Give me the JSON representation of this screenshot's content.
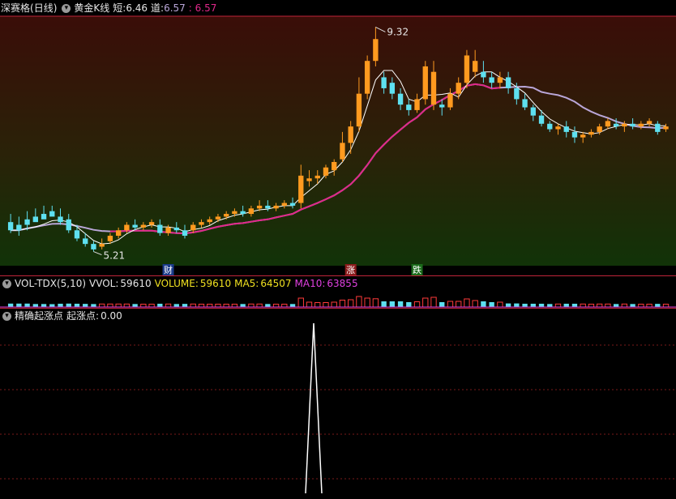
{
  "main": {
    "stock_name": "深赛格",
    "period": "(日线)",
    "indicator_name": "黄金K线",
    "short_label": "短:",
    "short_value": "6.46",
    "mid_label": "道:",
    "mid_value": "6.57",
    "third_value": ": 6.57",
    "high_label": "9.32",
    "low_label": "5.21",
    "markers": [
      "财",
      "涨",
      "跌"
    ],
    "colors": {
      "up": "#ff9a1f",
      "down": "#5ee0f0",
      "short_ma": "#ffffff",
      "long_ma_a": "#b9a6d8",
      "long_ma_b": "#e0288a",
      "title_red": "#ff4040"
    }
  },
  "volume": {
    "name": "VOL-TDX(5,10)",
    "vvol_label": "VVOL:",
    "vvol_value": "59610",
    "volume_label": "VOLUME:",
    "volume_value": "59610",
    "ma5_label": "MA5:",
    "ma5_value": "64507",
    "ma10_label": "MA10:",
    "ma10_value": "63855"
  },
  "indicator": {
    "name": "精确起涨点",
    "field_label": "起涨点:",
    "field_value": "0.00"
  },
  "chart_data": {
    "type": "candlestick",
    "high_marker": 9.32,
    "low_marker": 5.21,
    "candles": [
      [
        5.75,
        5.9,
        5.6,
        5.55,
        0
      ],
      [
        5.7,
        5.85,
        5.6,
        5.5,
        0
      ],
      [
        5.8,
        5.95,
        5.7,
        5.6,
        0
      ],
      [
        5.85,
        6.0,
        5.75,
        5.8,
        0
      ],
      [
        5.9,
        6.05,
        5.8,
        5.85,
        0
      ],
      [
        5.95,
        6.05,
        5.85,
        5.9,
        0
      ],
      [
        5.85,
        6.0,
        5.75,
        5.7,
        0
      ],
      [
        5.8,
        5.9,
        5.6,
        5.55,
        0
      ],
      [
        5.6,
        5.7,
        5.45,
        5.4,
        0
      ],
      [
        5.45,
        5.55,
        5.35,
        5.3,
        0
      ],
      [
        5.35,
        5.4,
        5.25,
        5.21,
        0
      ],
      [
        5.3,
        5.45,
        5.35,
        5.25,
        1
      ],
      [
        5.4,
        5.55,
        5.5,
        5.35,
        1
      ],
      [
        5.5,
        5.65,
        5.6,
        5.45,
        1
      ],
      [
        5.6,
        5.75,
        5.7,
        5.55,
        1
      ],
      [
        5.7,
        5.8,
        5.65,
        5.6,
        0
      ],
      [
        5.65,
        5.75,
        5.7,
        5.6,
        1
      ],
      [
        5.7,
        5.8,
        5.75,
        5.65,
        1
      ],
      [
        5.7,
        5.8,
        5.55,
        5.5,
        0
      ],
      [
        5.55,
        5.7,
        5.65,
        5.5,
        1
      ],
      [
        5.65,
        5.75,
        5.6,
        5.55,
        0
      ],
      [
        5.6,
        5.7,
        5.5,
        5.45,
        0
      ],
      [
        5.6,
        5.75,
        5.7,
        5.55,
        1
      ],
      [
        5.7,
        5.8,
        5.75,
        5.65,
        1
      ],
      [
        5.75,
        5.85,
        5.8,
        5.7,
        1
      ],
      [
        5.8,
        5.9,
        5.85,
        5.75,
        1
      ],
      [
        5.85,
        5.95,
        5.9,
        5.8,
        1
      ],
      [
        5.9,
        6.0,
        5.95,
        5.85,
        1
      ],
      [
        5.95,
        6.05,
        5.9,
        5.85,
        0
      ],
      [
        5.9,
        6.05,
        6.0,
        5.85,
        1
      ],
      [
        6.0,
        6.15,
        6.05,
        5.95,
        1
      ],
      [
        6.05,
        6.15,
        6.0,
        5.95,
        0
      ],
      [
        6.0,
        6.1,
        6.05,
        5.95,
        1
      ],
      [
        6.05,
        6.15,
        6.1,
        6.0,
        1
      ],
      [
        6.1,
        6.2,
        6.05,
        6.0,
        0
      ],
      [
        6.1,
        6.8,
        6.6,
        6.0,
        1
      ],
      [
        6.5,
        6.7,
        6.55,
        6.4,
        1
      ],
      [
        6.55,
        6.7,
        6.6,
        6.45,
        1
      ],
      [
        6.6,
        6.8,
        6.75,
        6.55,
        1
      ],
      [
        6.7,
        6.9,
        6.85,
        6.6,
        1
      ],
      [
        6.9,
        7.4,
        7.2,
        6.85,
        1
      ],
      [
        7.2,
        7.6,
        7.5,
        7.0,
        1
      ],
      [
        7.5,
        8.4,
        8.1,
        7.4,
        1
      ],
      [
        8.1,
        8.8,
        8.7,
        8.0,
        1
      ],
      [
        8.7,
        9.32,
        9.1,
        8.6,
        1
      ],
      [
        8.4,
        8.5,
        8.2,
        8.1,
        0
      ],
      [
        8.3,
        8.4,
        8.1,
        8.0,
        0
      ],
      [
        8.1,
        8.2,
        7.9,
        7.8,
        0
      ],
      [
        7.9,
        8.0,
        7.8,
        7.7,
        0
      ],
      [
        7.8,
        8.1,
        8.0,
        7.75,
        1
      ],
      [
        8.0,
        8.7,
        8.6,
        7.9,
        1
      ],
      [
        8.5,
        8.7,
        7.9,
        7.8,
        1
      ],
      [
        7.9,
        8.0,
        7.85,
        7.7,
        0
      ],
      [
        7.85,
        8.2,
        8.1,
        7.8,
        1
      ],
      [
        8.1,
        8.4,
        8.3,
        8.0,
        1
      ],
      [
        8.3,
        8.9,
        8.8,
        8.2,
        1
      ],
      [
        8.7,
        8.9,
        8.5,
        8.4,
        1
      ],
      [
        8.5,
        8.7,
        8.4,
        8.3,
        0
      ],
      [
        8.4,
        8.5,
        8.3,
        8.2,
        0
      ],
      [
        8.3,
        8.5,
        8.4,
        8.2,
        1
      ],
      [
        8.4,
        8.5,
        8.2,
        8.1,
        0
      ],
      [
        8.2,
        8.3,
        8.0,
        7.9,
        0
      ],
      [
        8.0,
        8.1,
        7.85,
        7.8,
        0
      ],
      [
        7.85,
        7.9,
        7.7,
        7.6,
        0
      ],
      [
        7.7,
        7.8,
        7.55,
        7.5,
        0
      ],
      [
        7.55,
        7.6,
        7.45,
        7.4,
        0
      ],
      [
        7.45,
        7.55,
        7.5,
        7.35,
        1
      ],
      [
        7.5,
        7.6,
        7.4,
        7.3,
        0
      ],
      [
        7.4,
        7.5,
        7.3,
        7.2,
        0
      ],
      [
        7.3,
        7.4,
        7.35,
        7.2,
        1
      ],
      [
        7.35,
        7.45,
        7.4,
        7.3,
        1
      ],
      [
        7.4,
        7.55,
        7.5,
        7.35,
        1
      ],
      [
        7.5,
        7.65,
        7.6,
        7.45,
        1
      ],
      [
        7.55,
        7.65,
        7.5,
        7.45,
        0
      ],
      [
        7.5,
        7.6,
        7.55,
        7.4,
        1
      ],
      [
        7.55,
        7.65,
        7.5,
        7.45,
        0
      ],
      [
        7.5,
        7.6,
        7.55,
        7.45,
        1
      ],
      [
        7.55,
        7.65,
        7.6,
        7.5,
        1
      ],
      [
        7.55,
        7.6,
        7.4,
        7.35,
        0
      ],
      [
        7.45,
        7.55,
        7.5,
        7.4,
        1
      ]
    ],
    "spike_value": 1
  }
}
